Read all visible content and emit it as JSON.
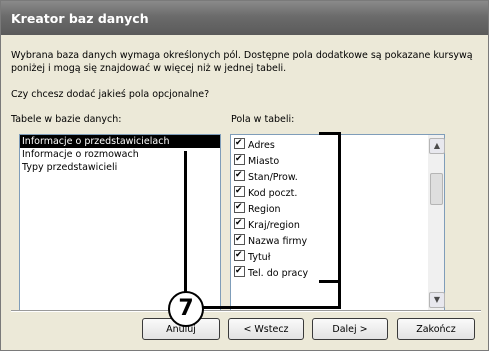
{
  "window": {
    "title": "Kreator baz danych"
  },
  "intro_text": "Wybrana baza danych wymaga określonych pól. Dostępne pola dodatkowe są pokazane kursywą poniżej i mogą się znajdować w więcej niż w jednej tabeli.",
  "question": "Czy chcesz dodać jakieś pola opcjonalne?",
  "tables_label": "Tabele w bazie danych:",
  "fields_label": "Pola w tabeli:",
  "tables": [
    {
      "label": "Informacje o przedstawicielach",
      "selected": true
    },
    {
      "label": "Informacje o rozmowach",
      "selected": false
    },
    {
      "label": "Typy przedstawicieli",
      "selected": false
    }
  ],
  "fields": [
    {
      "label": "Adres",
      "checked": true
    },
    {
      "label": "Miasto",
      "checked": true
    },
    {
      "label": "Stan/Prow.",
      "checked": true
    },
    {
      "label": "Kod poczt.",
      "checked": true
    },
    {
      "label": "Region",
      "checked": true
    },
    {
      "label": "Kraj/region",
      "checked": true
    },
    {
      "label": "Nazwa firmy",
      "checked": true
    },
    {
      "label": "Tytuł",
      "checked": true
    },
    {
      "label": "Tel. do pracy",
      "checked": true
    }
  ],
  "buttons": {
    "cancel": "Anuluj",
    "back": "< Wstecz",
    "next": "Dalej >",
    "finish": "Zakończ"
  },
  "callout": {
    "number": "7"
  }
}
